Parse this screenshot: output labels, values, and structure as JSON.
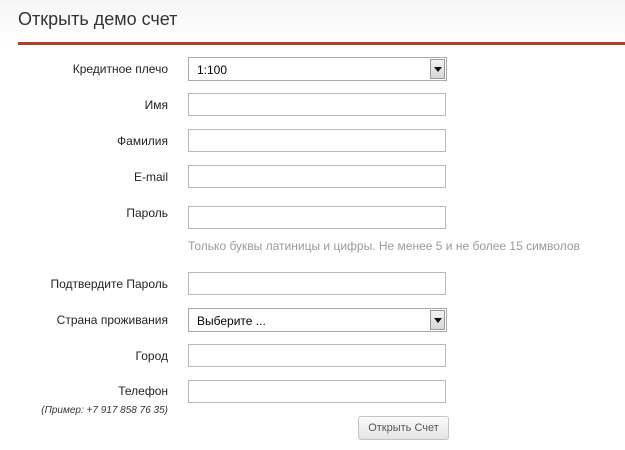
{
  "page": {
    "title": "Открыть демо счет"
  },
  "form": {
    "leverage": {
      "label": "Кредитное плечо",
      "value": "1:100"
    },
    "first_name": {
      "label": "Имя",
      "value": ""
    },
    "last_name": {
      "label": "Фамилия",
      "value": ""
    },
    "email": {
      "label": "E-mail",
      "value": ""
    },
    "password": {
      "label": "Пароль",
      "value": "",
      "hint": "Только буквы латиницы и цифры. Не менее 5 и не более 15 символов"
    },
    "confirm_password": {
      "label": "Подтвердите Пароль",
      "value": ""
    },
    "country": {
      "label": "Страна проживания",
      "value": "Выберите ..."
    },
    "city": {
      "label": "Город",
      "value": ""
    },
    "phone": {
      "label": "Телефон",
      "value": "",
      "example": "(Пример: +7 917 858 76 35)"
    },
    "submit_label": "Открыть Счет"
  },
  "colors": {
    "accent_rule": "#b0402c",
    "hint_text": "#9a9a9a"
  }
}
